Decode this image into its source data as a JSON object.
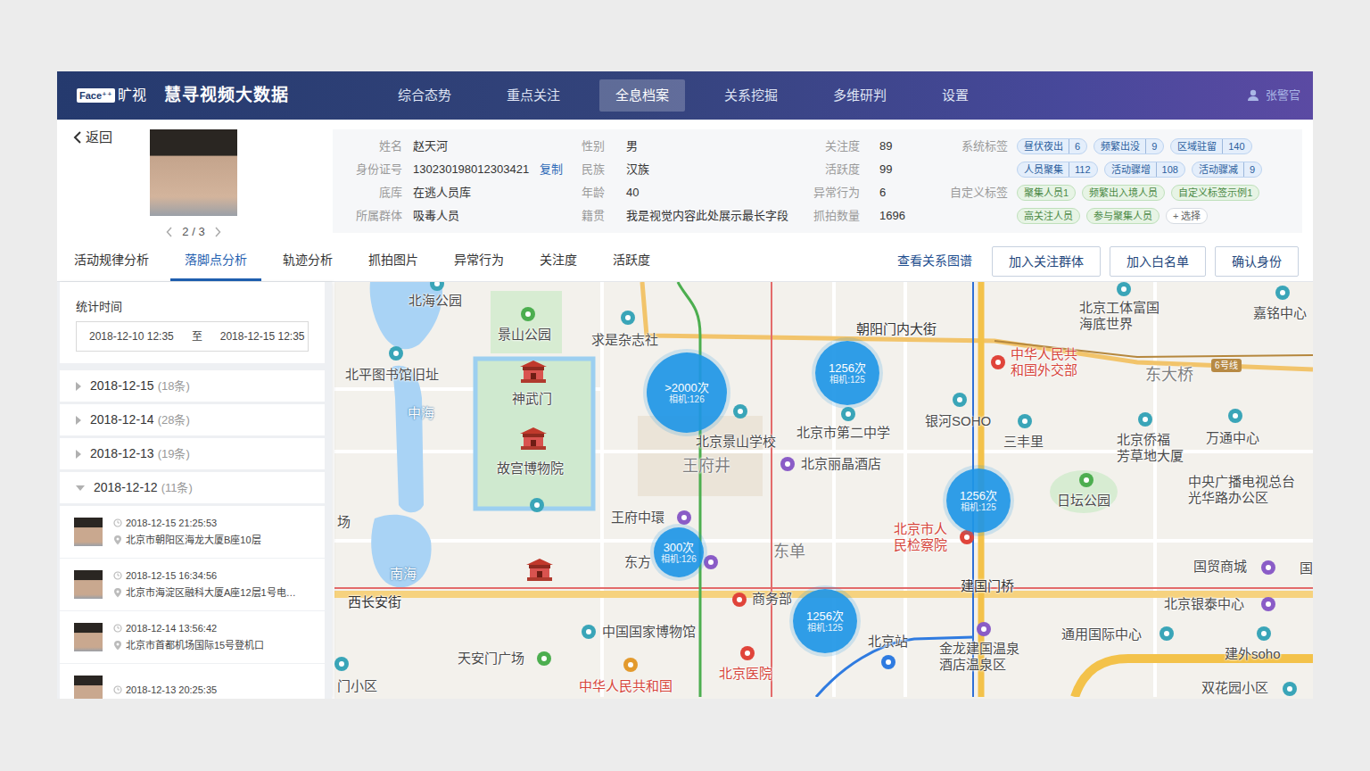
{
  "header": {
    "logo_mark": "Face⁺⁺",
    "logo_name": "旷视",
    "title": "慧寻视频大数据",
    "nav": [
      {
        "label": "综合态势",
        "selected": false
      },
      {
        "label": "重点关注",
        "selected": false
      },
      {
        "label": "全息档案",
        "selected": true
      },
      {
        "label": "关系挖掘",
        "selected": false
      },
      {
        "label": "多维研判",
        "selected": false
      },
      {
        "label": "设置",
        "selected": false
      }
    ],
    "user": "张警官"
  },
  "profile": {
    "back": "返回",
    "pager": "2 / 3",
    "fields": [
      [
        {
          "label": "姓名",
          "value": "赵天河"
        },
        {
          "label": "身份证号",
          "value": "130230198012303421",
          "action": "复制"
        },
        {
          "label": "底库",
          "value": "在逃人员库"
        },
        {
          "label": "所属群体",
          "value": "吸毒人员"
        }
      ],
      [
        {
          "label": "性别",
          "value": "男"
        },
        {
          "label": "民族",
          "value": "汉族"
        },
        {
          "label": "年龄",
          "value": "40"
        },
        {
          "label": "籍贯",
          "value": "我是视觉内容此处展示最长字段"
        }
      ],
      [
        {
          "label": "关注度",
          "value": "89"
        },
        {
          "label": "活跃度",
          "value": "99"
        },
        {
          "label": "异常行为",
          "value": "6"
        },
        {
          "label": "抓拍数量",
          "value": "1696"
        }
      ]
    ],
    "system_tags": {
      "label": "系统标签",
      "items": [
        {
          "name": "昼伏夜出",
          "count": "6"
        },
        {
          "name": "频繁出没",
          "count": "9"
        },
        {
          "name": "区域驻留",
          "count": "140"
        },
        {
          "name": "人员聚集",
          "count": "112"
        },
        {
          "name": "活动骤增",
          "count": "108"
        },
        {
          "name": "活动骤减",
          "count": "9"
        }
      ]
    },
    "custom_tags": {
      "label": "自定义标签",
      "items": [
        "聚集人员1",
        "频繁出入境人员",
        "自定义标签示例1",
        "高关注人员",
        "参与聚集人员"
      ],
      "add": "+ 选择"
    }
  },
  "tabs": [
    {
      "label": "活动规律分析",
      "selected": false
    },
    {
      "label": "落脚点分析",
      "selected": true
    },
    {
      "label": "轨迹分析",
      "selected": false
    },
    {
      "label": "抓拍图片",
      "selected": false
    },
    {
      "label": "异常行为",
      "selected": false
    },
    {
      "label": "关注度",
      "selected": false
    },
    {
      "label": "活跃度",
      "selected": false
    }
  ],
  "actions": {
    "graph_link": "查看关系图谱",
    "buttons": [
      "加入关注群体",
      "加入白名单",
      "确认身份"
    ]
  },
  "sidebar": {
    "time_label": "统计时间",
    "start": "2018-12-10 12:35",
    "sep": "至",
    "end": "2018-12-15 12:35",
    "days": [
      {
        "date": "2018-12-15",
        "count": "(18条)",
        "expanded": false
      },
      {
        "date": "2018-12-14",
        "count": "(28条)",
        "expanded": false
      },
      {
        "date": "2018-12-13",
        "count": "(19条)",
        "expanded": false
      },
      {
        "date": "2018-12-12",
        "count": "(11条)",
        "expanded": true
      }
    ],
    "records": [
      {
        "time": "2018-12-15 21:25:53",
        "place": "北京市朝阳区海龙大厦B座10层"
      },
      {
        "time": "2018-12-15 16:34:56",
        "place": "北京市海淀区融科大厦A座12层1号电…"
      },
      {
        "time": "2018-12-14 13:56:42",
        "place": "北京市首都机场国际15号登机口"
      },
      {
        "time": "2018-12-13 20:25:35"
      }
    ]
  },
  "map": {
    "line_badge": "6号线",
    "clusters": [
      {
        "count": ">2000次",
        "camera": "相机:126"
      },
      {
        "count": "1256次",
        "camera": "相机:125"
      },
      {
        "count": "1256次",
        "camera": "相机:125"
      },
      {
        "count": "300次",
        "camera": "相机:126"
      },
      {
        "count": "1256次",
        "camera": "相机:125"
      }
    ],
    "labels": [
      {
        "text": "北海公园",
        "kind": "poi"
      },
      {
        "text": "景山公园",
        "kind": "poi"
      },
      {
        "text": "求是杂志社",
        "kind": "poi"
      },
      {
        "text": "北平图书馆旧址",
        "kind": "poi"
      },
      {
        "text": "神武门",
        "kind": "poi"
      },
      {
        "text": "故宫博物院",
        "kind": "poi"
      },
      {
        "text": "中海",
        "kind": "water"
      },
      {
        "text": "南海",
        "kind": "water"
      },
      {
        "text": "王府井",
        "kind": "area"
      },
      {
        "text": "北京景山学校",
        "kind": "poi"
      },
      {
        "text": "北京市第二中学",
        "kind": "poi"
      },
      {
        "text": "北京丽晶酒店",
        "kind": "poi"
      },
      {
        "text": "银河SOHO",
        "kind": "poi"
      },
      {
        "text": "三丰里",
        "kind": "poi"
      },
      {
        "text": "北京侨福\n芳草地大厦",
        "kind": "poi"
      },
      {
        "text": "万通中心",
        "kind": "poi"
      },
      {
        "text": "中央广播电视总台\n光华路办公区",
        "kind": "poi"
      },
      {
        "text": "日坛公园",
        "kind": "poi"
      },
      {
        "text": "北京工体富国\n海底世界",
        "kind": "poi"
      },
      {
        "text": "嘉铭中心",
        "kind": "poi"
      },
      {
        "text": "朝阳门内大街",
        "kind": "road"
      },
      {
        "text": "中华人民共\n和国外交部",
        "kind": "red"
      },
      {
        "text": "东大桥",
        "kind": "area"
      },
      {
        "text": "王府中環",
        "kind": "poi"
      },
      {
        "text": "东方",
        "kind": "poi"
      },
      {
        "text": "东单",
        "kind": "area"
      },
      {
        "text": "北京市人\n民检察院",
        "kind": "red"
      },
      {
        "text": "建国门桥",
        "kind": "road"
      },
      {
        "text": "国贸商城",
        "kind": "poi"
      },
      {
        "text": "国",
        "kind": "poi"
      },
      {
        "text": "北京银泰中心",
        "kind": "poi"
      },
      {
        "text": "西长安街",
        "kind": "road"
      },
      {
        "text": "商务部",
        "kind": "poi"
      },
      {
        "text": "中国国家博物馆",
        "kind": "poi"
      },
      {
        "text": "天安门广场",
        "kind": "poi"
      },
      {
        "text": "中华人民共和国",
        "kind": "red"
      },
      {
        "text": "北京医院",
        "kind": "red"
      },
      {
        "text": "北京站",
        "kind": "poi"
      },
      {
        "text": "金龙建国温泉\n酒店温泉区",
        "kind": "poi"
      },
      {
        "text": "通用国际中心",
        "kind": "poi"
      },
      {
        "text": "建外soho",
        "kind": "poi"
      },
      {
        "text": "双花园小区",
        "kind": "poi"
      },
      {
        "text": "门小区",
        "kind": "poi"
      },
      {
        "text": "场",
        "kind": "poi"
      }
    ]
  }
}
